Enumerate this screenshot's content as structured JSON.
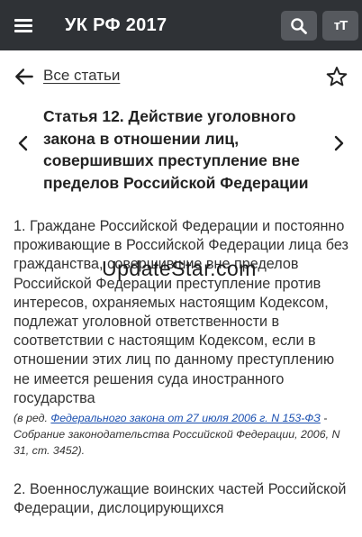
{
  "app_bar": {
    "title": "УК РФ 2017",
    "menu_icon": "hamburger-menu-icon",
    "search_icon": "search-icon",
    "text_size_icon": "text-size-icon",
    "text_size_glyph": "тТ"
  },
  "nav": {
    "back_icon": "arrow-left-icon",
    "all_articles_label": "Все статьи",
    "favorite_icon": "star-outline-icon",
    "prev_icon": "chevron-left-icon",
    "next_icon": "chevron-right-icon"
  },
  "article": {
    "title": "Статья 12. Действие уголовного закона в отношении лиц, совершивших преступление вне пределов Российской Федерации",
    "paragraphs": [
      "1. Граждане Российской Федерации и постоянно проживающие в Российской Федерации лица без гражданства, совершившие вне пределов Российской Федерации преступление против интересов, охраняемых настоящим Кодексом, подлежат уголовной ответственности в соответствии с настоящим Кодексом, если в отношении этих лиц по данному преступлению не имеется решения суда иностранного государства",
      "2. Военнослужащие воинских частей Российской Федерации, дислоцирующихся"
    ],
    "note_prefix": "(в ред. ",
    "note_link": "Федерального закона от 27 июля 2006 г. N 153-ФЗ",
    "note_suffix": " - Собрание законодательства Российской Федерации, 2006, N 31, ст. 3452)."
  },
  "watermark": "UpdateStar.com"
}
